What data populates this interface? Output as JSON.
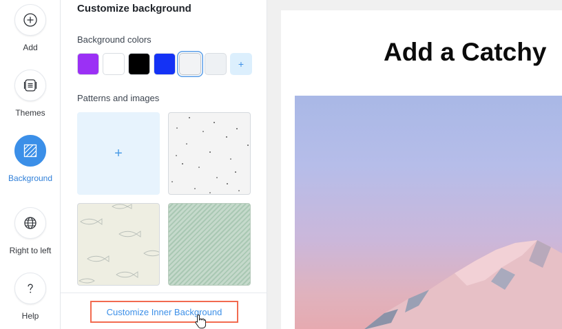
{
  "rail": {
    "items": [
      {
        "label": "Add",
        "icon": "plus-circle-icon",
        "active": false
      },
      {
        "label": "Themes",
        "icon": "themes-icon",
        "active": false
      },
      {
        "label": "Background",
        "icon": "background-hatch-icon",
        "active": true
      },
      {
        "label": "Right to left",
        "icon": "globe-icon",
        "active": false
      },
      {
        "label": "Help",
        "icon": "question-icon",
        "active": false
      }
    ]
  },
  "panel": {
    "title": "Customize background",
    "colors_label": "Background colors",
    "swatches": [
      {
        "color": "#9b30f5",
        "selected": false
      },
      {
        "color": "#ffffff",
        "selected": false
      },
      {
        "color": "#000000",
        "selected": false
      },
      {
        "color": "#1432f5",
        "selected": false
      },
      {
        "color": "#f2f3f5",
        "selected": true
      },
      {
        "color": "#eef1f4",
        "selected": false
      }
    ],
    "add_swatch_symbol": "+",
    "patterns_label": "Patterns and images",
    "add_tile_symbol": "+",
    "footer_link": "Customize Inner Background"
  },
  "preview": {
    "title": "Add a Catchy"
  },
  "colors": {
    "accent": "#3b8fe8",
    "highlight_border": "#f26a4f"
  }
}
